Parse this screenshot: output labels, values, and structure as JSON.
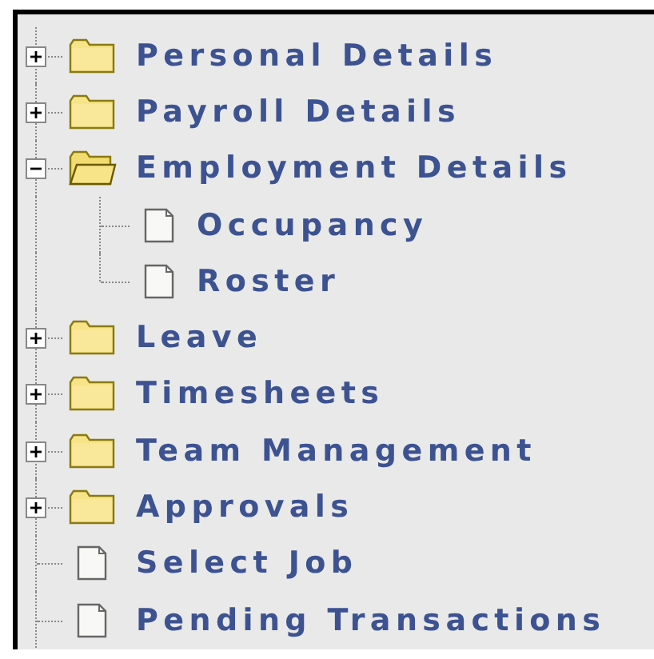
{
  "tree": [
    {
      "kind": "folder",
      "label": "Personal Details",
      "expanded": false
    },
    {
      "kind": "folder",
      "label": "Payroll Details",
      "expanded": false
    },
    {
      "kind": "folder",
      "label": "Employment Details",
      "expanded": true,
      "children": [
        {
          "kind": "document",
          "label": "Occupancy"
        },
        {
          "kind": "document",
          "label": "Roster"
        }
      ]
    },
    {
      "kind": "folder",
      "label": "Leave",
      "expanded": false
    },
    {
      "kind": "folder",
      "label": "Timesheets",
      "expanded": false
    },
    {
      "kind": "folder",
      "label": "Team Management",
      "expanded": false
    },
    {
      "kind": "folder",
      "label": "Approvals",
      "expanded": false
    },
    {
      "kind": "document",
      "label": "Select Job"
    },
    {
      "kind": "document",
      "label": "Pending Transactions"
    }
  ]
}
